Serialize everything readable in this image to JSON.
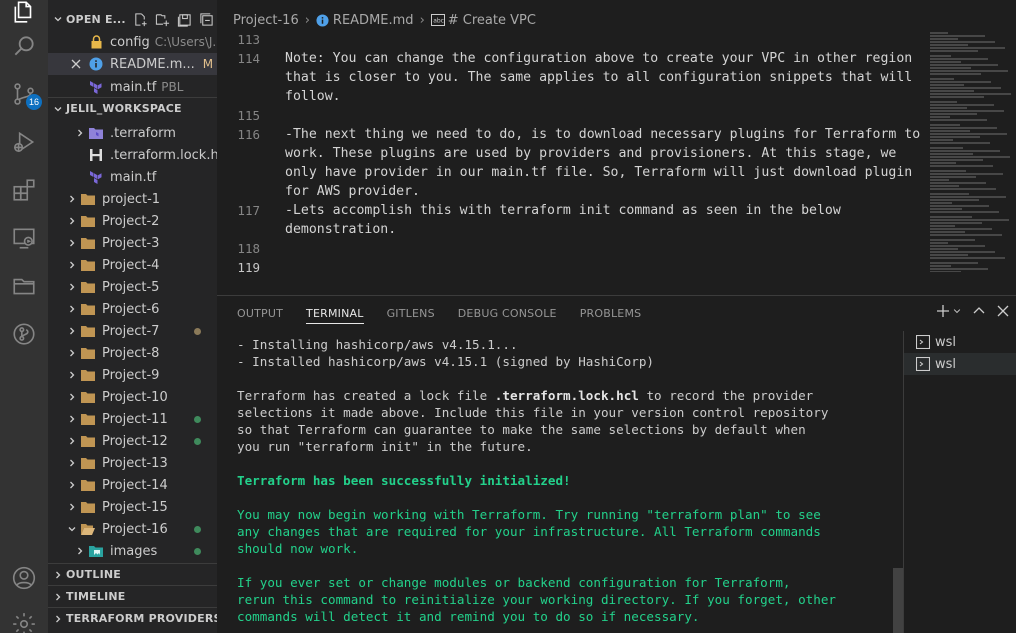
{
  "activity_bar": {
    "items": [
      {
        "name": "explorer-icon"
      },
      {
        "name": "search-icon"
      },
      {
        "name": "source-control-icon",
        "badge": "16"
      },
      {
        "name": "run-debug-icon"
      },
      {
        "name": "extensions-icon"
      },
      {
        "name": "remote-explorer-icon"
      },
      {
        "name": "folder-icon"
      },
      {
        "name": "gitlens-icon"
      },
      {
        "name": "account-icon"
      },
      {
        "name": "settings-gear-icon"
      }
    ]
  },
  "sidebar": {
    "open_editors": {
      "title": "OPEN E...",
      "items": [
        {
          "label": "config",
          "hint": "C:\\Users\\J..."
        },
        {
          "label": "README.m...",
          "hint": "M"
        },
        {
          "label": "main.tf",
          "hint": "PBL"
        }
      ]
    },
    "workspace": {
      "title": "JELIL_WORKSPACE",
      "items": [
        {
          "label": ".terraform"
        },
        {
          "label": ".terraform.lock.hcl"
        },
        {
          "label": "main.tf"
        },
        {
          "label": "project-1"
        },
        {
          "label": "Project-2"
        },
        {
          "label": "Project-3"
        },
        {
          "label": "Project-4"
        },
        {
          "label": "Project-5"
        },
        {
          "label": "Project-6"
        },
        {
          "label": "Project-7"
        },
        {
          "label": "Project-8"
        },
        {
          "label": "Project-9"
        },
        {
          "label": "Project-10"
        },
        {
          "label": "Project-11"
        },
        {
          "label": "Project-12"
        },
        {
          "label": "Project-13"
        },
        {
          "label": "Project-14"
        },
        {
          "label": "Project-15"
        },
        {
          "label": "Project-16"
        },
        {
          "label": "images"
        }
      ]
    },
    "sections": [
      {
        "title": "OUTLINE"
      },
      {
        "title": "TIMELINE"
      },
      {
        "title": "TERRAFORM PROVIDERS"
      }
    ]
  },
  "breadcrumb": {
    "items": [
      "Project-16",
      "README.md",
      "# Create VPC"
    ]
  },
  "editor": {
    "lines": [
      {
        "num": "113",
        "text": ""
      },
      {
        "num": "114",
        "text": "Note: You can change the configuration above to create your VPC in other region"
      },
      {
        "num": "",
        "text": "that is closer to you. The same applies to all configuration snippets that will"
      },
      {
        "num": "",
        "text": "follow."
      },
      {
        "num": "115",
        "text": ""
      },
      {
        "num": "116",
        "text": "-The next thing we need to do, is to download necessary plugins for Terraform to"
      },
      {
        "num": "",
        "text": "work. These plugins are used by providers and provisioners. At this stage, we"
      },
      {
        "num": "",
        "text": "only have provider in our main.tf file. So, Terraform will just download plugin"
      },
      {
        "num": "",
        "text": "for AWS provider."
      },
      {
        "num": "117",
        "text": "-Lets accomplish this with terraform init command as seen in the below"
      },
      {
        "num": "",
        "text": "demonstration."
      },
      {
        "num": "118",
        "text": ""
      },
      {
        "num": "119",
        "text": ""
      }
    ]
  },
  "panel": {
    "tabs": [
      "OUTPUT",
      "TERMINAL",
      "GITLENS",
      "DEBUG CONSOLE",
      "PROBLEMS"
    ],
    "active_tab": "TERMINAL",
    "terminals": [
      "wsl",
      "wsl"
    ],
    "terminal_lines": [
      {
        "text": "- Installing hashicorp/aws v4.15.1...",
        "style": "normal"
      },
      {
        "text": "- Installed hashicorp/aws v4.15.1 (signed by HashiCorp)",
        "style": "normal"
      },
      {
        "text": "",
        "style": "normal"
      },
      {
        "pre": "Terraform has created a lock file ",
        "bold": ".terraform.lock.hcl",
        "post": " to record the provider",
        "style": "normal"
      },
      {
        "text": "selections it made above. Include this file in your version control repository",
        "style": "normal"
      },
      {
        "text": "so that Terraform can guarantee to make the same selections by default when",
        "style": "normal"
      },
      {
        "text": "you run \"terraform init\" in the future.",
        "style": "normal"
      },
      {
        "text": "",
        "style": "normal"
      },
      {
        "bold": "Terraform has been successfully initialized!",
        "style": "green"
      },
      {
        "text": "",
        "style": "green"
      },
      {
        "text": "You may now begin working with Terraform. Try running \"terraform plan\" to see",
        "style": "green"
      },
      {
        "text": "any changes that are required for your infrastructure. All Terraform commands",
        "style": "green"
      },
      {
        "text": "should now work.",
        "style": "green"
      },
      {
        "text": "",
        "style": "green"
      },
      {
        "text": "If you ever set or change modules or backend configuration for Terraform,",
        "style": "green"
      },
      {
        "text": "rerun this command to reinitialize your working directory. If you forget, other",
        "style": "green"
      },
      {
        "text": "commands will detect it and remind you to do so if necessary.",
        "style": "green"
      }
    ]
  },
  "colors": {
    "modified": "#e2c08d",
    "untracked": "#73c991",
    "terminal_green": "#23d18b",
    "accent": "#0e70c0"
  }
}
